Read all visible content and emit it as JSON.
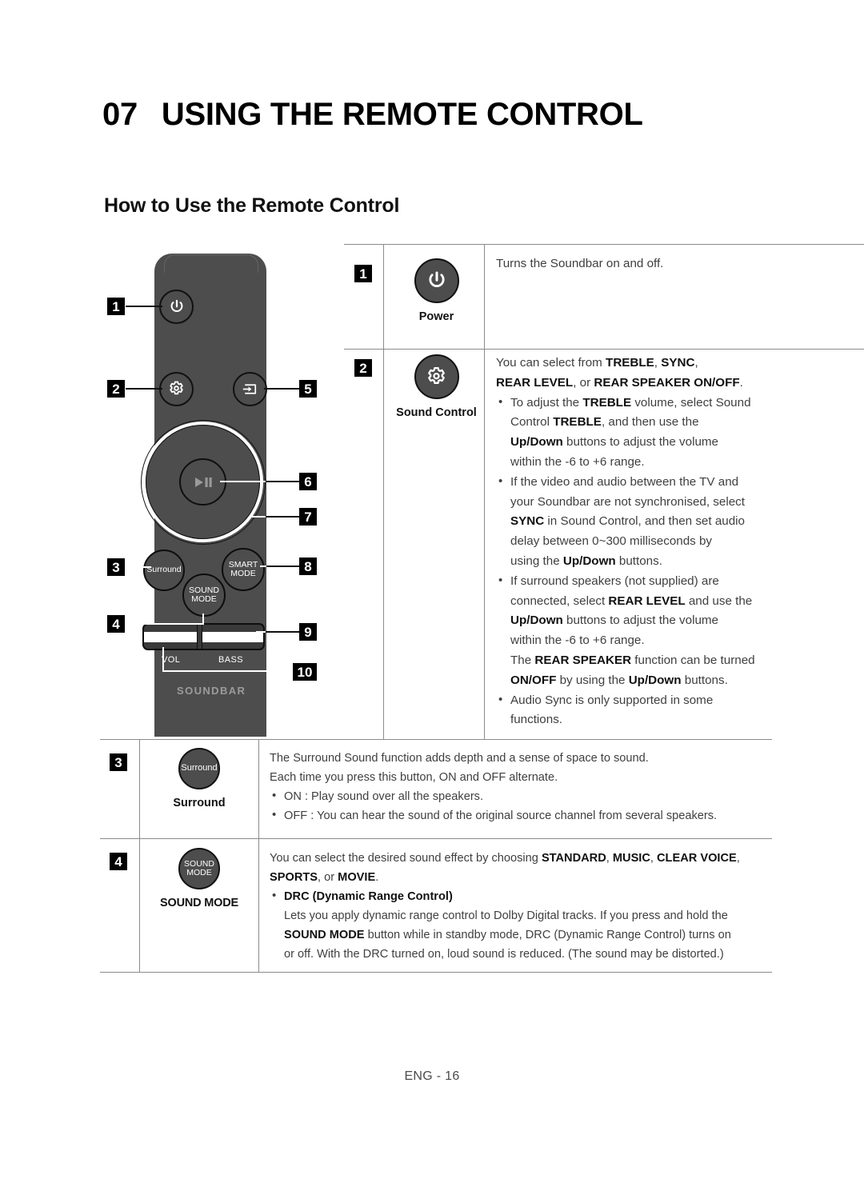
{
  "header": {
    "chapter_number": "07",
    "chapter_title": "USING THE REMOTE CONTROL",
    "section_title": "How to Use the Remote Control"
  },
  "remote": {
    "buttons": {
      "power_icon": "power-icon",
      "gear_icon": "gear-icon",
      "source_icon": "source-input-icon",
      "play_pause_icon": "play-pause-icon",
      "surround": "Surround",
      "smart_mode_line1": "SMART",
      "smart_mode_line2": "MODE",
      "sound_mode_line1": "SOUND",
      "sound_mode_line2": "MODE"
    },
    "labels": {
      "vol": "VOL",
      "bass": "BASS",
      "brand": "SOUNDBAR"
    },
    "callouts": [
      "1",
      "2",
      "3",
      "4",
      "5",
      "6",
      "7",
      "8",
      "9",
      "10"
    ]
  },
  "table": {
    "rows": [
      {
        "number": "1",
        "icon": "power-icon",
        "icon_label": "Power",
        "lines": [
          [
            {
              "t": "Turns the Soundbar on and off.",
              "b": false
            }
          ]
        ],
        "bullets": []
      },
      {
        "number": "2",
        "icon": "gear-icon",
        "icon_label": "Sound Control",
        "lines": [
          [
            {
              "t": "You can select from ",
              "b": false
            },
            {
              "t": "TREBLE",
              "b": true
            },
            {
              "t": ", ",
              "b": false
            },
            {
              "t": "SYNC",
              "b": true
            },
            {
              "t": ",",
              "b": false
            }
          ],
          [
            {
              "t": "REAR LEVEL",
              "b": true
            },
            {
              "t": ", or ",
              "b": false
            },
            {
              "t": "REAR SPEAKER ON/OFF",
              "b": true
            },
            {
              "t": ".",
              "b": false
            }
          ]
        ],
        "bullets": [
          [
            [
              {
                "t": "To adjust the ",
                "b": false
              },
              {
                "t": "TREBLE",
                "b": true
              },
              {
                "t": " volume, select Sound",
                "b": false
              }
            ],
            [
              {
                "t": "Control ",
                "b": false
              },
              {
                "t": "TREBLE",
                "b": true
              },
              {
                "t": ", and then use the",
                "b": false
              }
            ],
            [
              {
                "t": "Up/Down",
                "b": true
              },
              {
                "t": " buttons to adjust the volume",
                "b": false
              }
            ],
            [
              {
                "t": "within the -6 to +6 range.",
                "b": false
              }
            ]
          ],
          [
            [
              {
                "t": "If the video and audio between the TV and",
                "b": false
              }
            ],
            [
              {
                "t": "your Soundbar are not synchronised, select",
                "b": false
              }
            ],
            [
              {
                "t": "SYNC",
                "b": true
              },
              {
                "t": " in Sound Control, and then set audio",
                "b": false
              }
            ],
            [
              {
                "t": "delay between 0~300 milliseconds by",
                "b": false
              }
            ],
            [
              {
                "t": "using the ",
                "b": false
              },
              {
                "t": "Up/Down",
                "b": true
              },
              {
                "t": " buttons.",
                "b": false
              }
            ]
          ],
          [
            [
              {
                "t": "If surround speakers (not supplied) are",
                "b": false
              }
            ],
            [
              {
                "t": "connected, select ",
                "b": false
              },
              {
                "t": "REAR LEVEL",
                "b": true
              },
              {
                "t": " and use the",
                "b": false
              }
            ],
            [
              {
                "t": "Up/Down",
                "b": true
              },
              {
                "t": " buttons to adjust the volume",
                "b": false
              }
            ],
            [
              {
                "t": "within the -6 to +6 range.",
                "b": false
              }
            ],
            [
              {
                "t": "The ",
                "b": false
              },
              {
                "t": "REAR SPEAKER",
                "b": true
              },
              {
                "t": " function can be turned",
                "b": false
              }
            ],
            [
              {
                "t": "ON/OFF",
                "b": true
              },
              {
                "t": " by using the ",
                "b": false
              },
              {
                "t": "Up/Down",
                "b": true
              },
              {
                "t": " buttons.",
                "b": false
              }
            ]
          ],
          [
            [
              {
                "t": "Audio Sync is only supported in some",
                "b": false
              }
            ],
            [
              {
                "t": "functions.",
                "b": false
              }
            ]
          ]
        ]
      },
      {
        "number": "3",
        "icon": "surround-button-icon",
        "icon_label": "Surround",
        "icon_text": "Surround",
        "lines": [
          [
            {
              "t": "The Surround Sound function adds depth and a sense of space to sound.",
              "b": false
            }
          ],
          [
            {
              "t": "Each time you press this button, ON and OFF alternate.",
              "b": false
            }
          ]
        ],
        "bullets": [
          [
            [
              {
                "t": "ON : Play sound over all the speakers.",
                "b": false
              }
            ]
          ],
          [
            [
              {
                "t": "OFF : You can hear the sound of the original source channel from several speakers.",
                "b": false
              }
            ]
          ]
        ]
      },
      {
        "number": "4",
        "icon": "sound-mode-button-icon",
        "icon_label": "SOUND MODE",
        "icon_text_line1": "SOUND",
        "icon_text_line2": "MODE",
        "lines": [
          [
            {
              "t": "You can select the desired sound effect by choosing ",
              "b": false
            },
            {
              "t": "STANDARD",
              "b": true
            },
            {
              "t": ", ",
              "b": false
            },
            {
              "t": "MUSIC",
              "b": true
            },
            {
              "t": ", ",
              "b": false
            },
            {
              "t": "CLEAR VOICE",
              "b": true
            },
            {
              "t": ",",
              "b": false
            }
          ],
          [
            {
              "t": "SPORTS",
              "b": true
            },
            {
              "t": ", or ",
              "b": false
            },
            {
              "t": "MOVIE",
              "b": true
            },
            {
              "t": ".",
              "b": false
            }
          ]
        ],
        "bullets": [
          [
            [
              {
                "t": "DRC (Dynamic Range Control)",
                "b": true
              }
            ],
            [
              {
                "t": "Lets you apply dynamic range control to Dolby Digital tracks. If you press and hold the",
                "b": false
              }
            ],
            [
              {
                "t": "SOUND MODE",
                "b": true
              },
              {
                "t": " button while in standby mode, DRC (Dynamic Range Control) turns on",
                "b": false
              }
            ],
            [
              {
                "t": "or off. With the DRC turned on, loud sound is reduced. (The sound may be distorted.)",
                "b": false
              }
            ]
          ]
        ]
      }
    ]
  },
  "footer": {
    "page_label": "ENG - 16"
  },
  "colors": {
    "remote_body": "#4d4d4d",
    "badge_bg": "#000000",
    "rule": "#8b8b8b",
    "body_text": "#3f3f3f"
  }
}
